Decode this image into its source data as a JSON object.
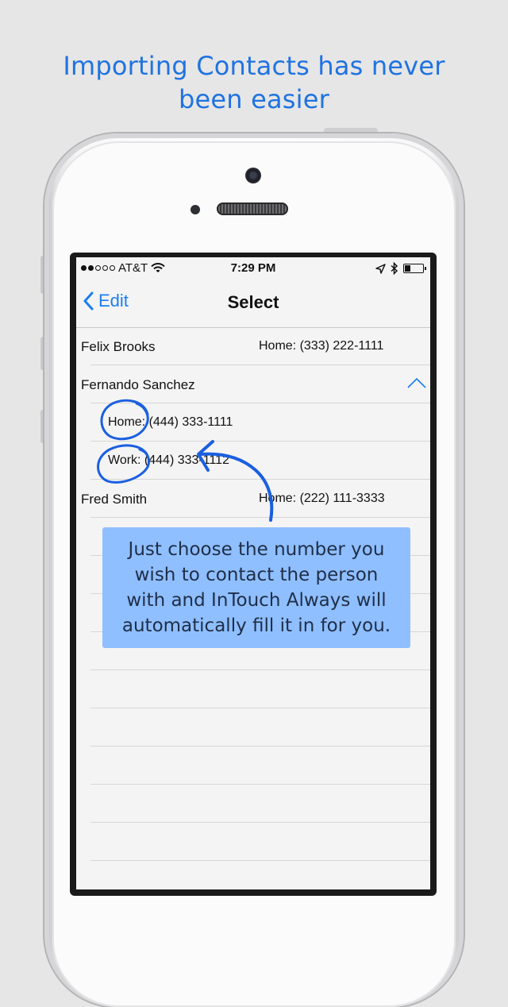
{
  "headline": {
    "line1": "Importing Contacts has never",
    "line2": "been easier"
  },
  "status_bar": {
    "carrier": "AT&T",
    "time": "7:29 PM",
    "signal_bars": 2,
    "signal_total": 5,
    "battery_level": 0.3
  },
  "nav": {
    "back_label": "Edit",
    "title": "Select"
  },
  "contacts": [
    {
      "name": "Felix Brooks",
      "phone": "Home: (333) 222-1111"
    },
    {
      "name": "Fernando Sanchez",
      "expanded": true,
      "numbers": [
        "Home: (444) 333-1111",
        "Work: (444) 333-1112"
      ]
    },
    {
      "name": "Fred Smith",
      "phone": "Home: (222) 111-3333"
    }
  ],
  "callout": {
    "line1": "Just choose the number you",
    "line2": "wish to contact the person",
    "line3": "with and InTouch Always will",
    "line4": "automatically fill it in for you."
  },
  "colors": {
    "headline": "#1f73e0",
    "callout_bg": "#8fbfff",
    "ios_blue": "#1a7ef0",
    "annotation": "#1a5fe0"
  },
  "icons": [
    "wifi-icon",
    "location-arrow-icon",
    "bluetooth-icon",
    "battery-icon",
    "chevron-left-icon",
    "chevron-up-icon"
  ]
}
